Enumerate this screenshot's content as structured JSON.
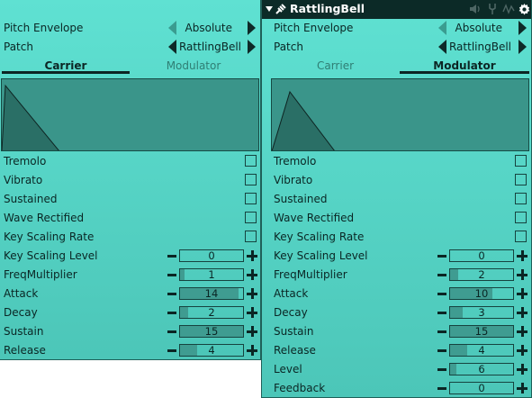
{
  "colors": {
    "panel_top": "#5fe1d2",
    "panel_bottom": "#4cc6b8",
    "fill": "#3f9c91",
    "dark": "#0c2624"
  },
  "carrier_panel": {
    "pitch_envelope": {
      "label": "Pitch Envelope",
      "value": "Absolute"
    },
    "patch": {
      "label": "Patch",
      "value": "RattlingBell"
    },
    "tabs": [
      {
        "label": "Carrier",
        "active": true
      },
      {
        "label": "Modulator",
        "active": false
      }
    ],
    "checkboxes": [
      {
        "label": "Tremolo",
        "checked": false
      },
      {
        "label": "Vibrato",
        "checked": false
      },
      {
        "label": "Sustained",
        "checked": false
      },
      {
        "label": "Wave Rectified",
        "checked": false
      },
      {
        "label": "Key Scaling Rate",
        "checked": false
      }
    ],
    "params": [
      {
        "label": "Key Scaling Level",
        "value": "0",
        "fill": 0.0
      },
      {
        "label": "FreqMultiplier",
        "value": "1",
        "fill": 0.07
      },
      {
        "label": "Attack",
        "value": "14",
        "fill": 0.93
      },
      {
        "label": "Decay",
        "value": "2",
        "fill": 0.13
      },
      {
        "label": "Sustain",
        "value": "15",
        "fill": 1.0
      },
      {
        "label": "Release",
        "value": "4",
        "fill": 0.27
      }
    ]
  },
  "modulator_panel": {
    "title": "RattlingBell",
    "title_icons": [
      "collapse-icon",
      "plugin-icon",
      "speaker-icon",
      "tuning-fork-icon",
      "wave-icon",
      "gear-icon"
    ],
    "pitch_envelope": {
      "label": "Pitch Envelope",
      "value": "Absolute"
    },
    "patch": {
      "label": "Patch",
      "value": "RattlingBell"
    },
    "tabs": [
      {
        "label": "Carrier",
        "active": false
      },
      {
        "label": "Modulator",
        "active": true
      }
    ],
    "checkboxes": [
      {
        "label": "Tremolo",
        "checked": false
      },
      {
        "label": "Vibrato",
        "checked": false
      },
      {
        "label": "Sustained",
        "checked": false
      },
      {
        "label": "Wave Rectified",
        "checked": false
      },
      {
        "label": "Key Scaling Rate",
        "checked": false
      }
    ],
    "params": [
      {
        "label": "Key Scaling Level",
        "value": "0",
        "fill": 0.0
      },
      {
        "label": "FreqMultiplier",
        "value": "2",
        "fill": 0.13
      },
      {
        "label": "Attack",
        "value": "10",
        "fill": 0.67
      },
      {
        "label": "Decay",
        "value": "3",
        "fill": 0.2
      },
      {
        "label": "Sustain",
        "value": "15",
        "fill": 1.0
      },
      {
        "label": "Release",
        "value": "4",
        "fill": 0.27
      },
      {
        "label": "Level",
        "value": "6",
        "fill": 0.1
      },
      {
        "label": "Feedback",
        "value": "0",
        "fill": 0.0
      }
    ]
  }
}
